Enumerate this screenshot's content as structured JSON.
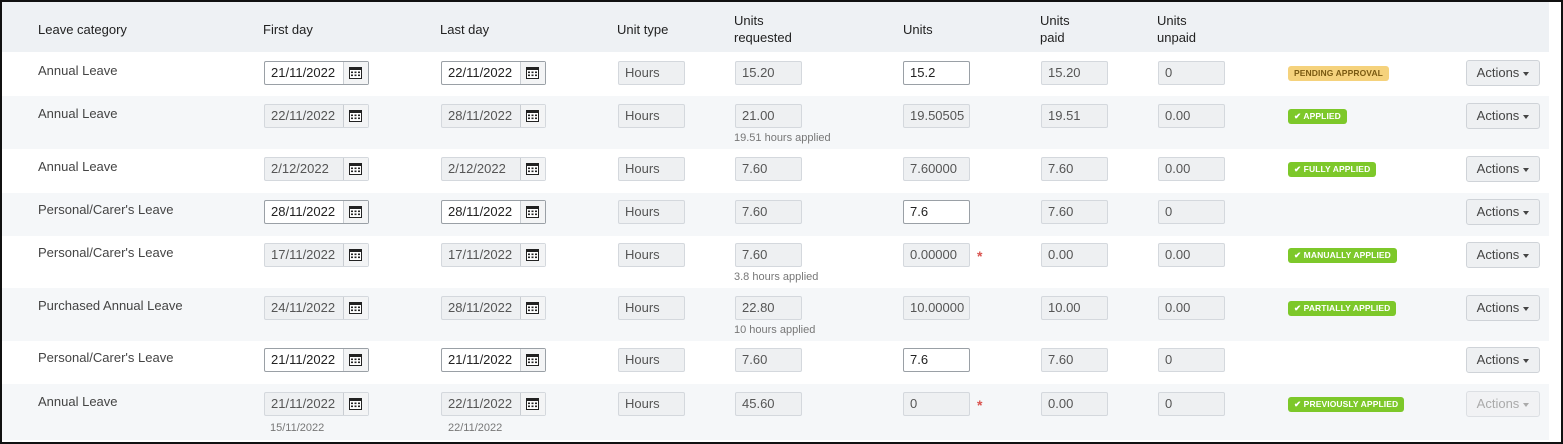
{
  "headers": {
    "leave_category": "Leave category",
    "first_day": "First day",
    "last_day": "Last day",
    "unit_type": "Unit type",
    "units_requested_line1": "Units",
    "units_requested_line2": "requested",
    "units": "Units",
    "units_paid_line1": "Units",
    "units_paid_line2": "paid",
    "units_unpaid_line1": "Units",
    "units_unpaid_line2": "unpaid"
  },
  "actions_label": "Actions",
  "rows": [
    {
      "category": "Annual Leave",
      "first_day": "21/11/2022",
      "last_day": "22/11/2022",
      "unit_type": "Hours",
      "units_requested": "15.20",
      "units": "15.2",
      "units_paid": "15.20",
      "units_unpaid": "0",
      "status": "PENDING APPROVAL"
    },
    {
      "category": "Annual Leave",
      "first_day": "22/11/2022",
      "last_day": "28/11/2022",
      "unit_type": "Hours",
      "units_requested": "21.00",
      "units_note": "19.51 hours applied",
      "units": "19.50505",
      "units_paid": "19.51",
      "units_unpaid": "0.00",
      "status": "✔ APPLIED"
    },
    {
      "category": "Annual Leave",
      "first_day": "2/12/2022",
      "last_day": "2/12/2022",
      "unit_type": "Hours",
      "units_requested": "7.60",
      "units": "7.60000",
      "units_paid": "7.60",
      "units_unpaid": "0.00",
      "status": "✔ FULLY APPLIED"
    },
    {
      "category": "Personal/Carer's Leave",
      "first_day": "28/11/2022",
      "last_day": "28/11/2022",
      "unit_type": "Hours",
      "units_requested": "7.60",
      "units": "7.6",
      "units_paid": "7.60",
      "units_unpaid": "0"
    },
    {
      "category": "Personal/Carer's Leave",
      "first_day": "17/11/2022",
      "last_day": "17/11/2022",
      "unit_type": "Hours",
      "units_requested": "7.60",
      "units_note": "3.8 hours applied",
      "units": "0.00000",
      "required_mark": "*",
      "units_paid": "0.00",
      "units_unpaid": "0.00",
      "status": "✔ MANUALLY APPLIED"
    },
    {
      "category": "Purchased Annual Leave",
      "first_day": "24/11/2022",
      "last_day": "28/11/2022",
      "unit_type": "Hours",
      "units_requested": "22.80",
      "units_note": "10 hours applied",
      "units": "10.00000",
      "units_paid": "10.00",
      "units_unpaid": "0.00",
      "status": "✔ PARTIALLY APPLIED"
    },
    {
      "category": "Personal/Carer's Leave",
      "first_day": "21/11/2022",
      "last_day": "21/11/2022",
      "unit_type": "Hours",
      "units_requested": "7.60",
      "units": "7.6",
      "units_paid": "7.60",
      "units_unpaid": "0"
    },
    {
      "category": "Annual Leave",
      "first_day": "21/11/2022",
      "first_day_note": "15/11/2022",
      "last_day": "22/11/2022",
      "last_day_note": "22/11/2022",
      "unit_type": "Hours",
      "units_requested": "45.60",
      "units": "0",
      "required_mark": "*",
      "units_paid": "0.00",
      "units_unpaid": "0",
      "status": "✔ PREVIOUSLY APPLIED"
    }
  ],
  "colors": {
    "badge_green": "#7dc82a",
    "badge_pending": "#f5d27c",
    "required": "#d9534f"
  }
}
